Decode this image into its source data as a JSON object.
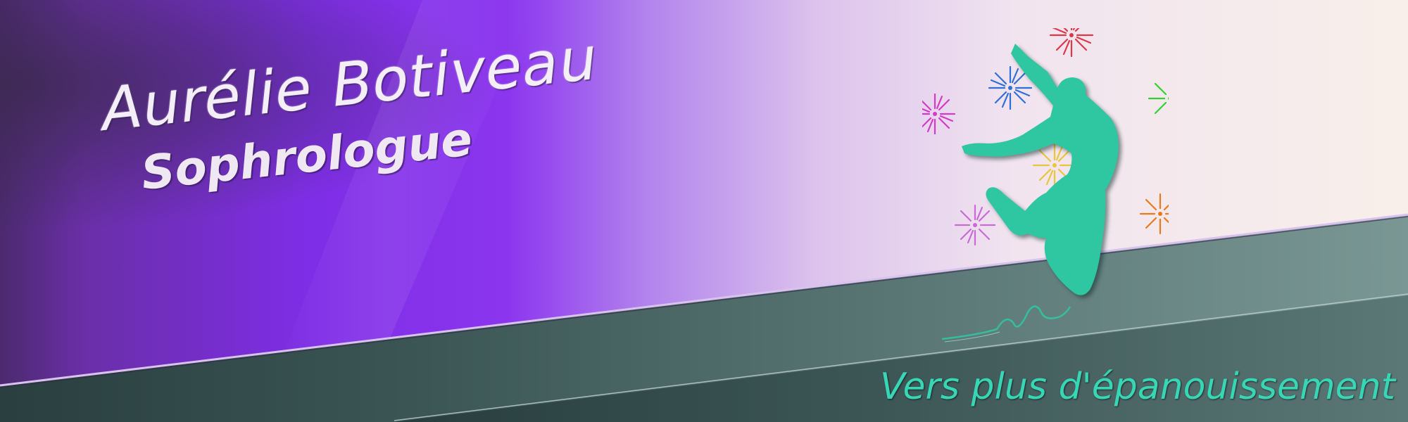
{
  "banner": {
    "name": "Aurélie Botiveau",
    "profession": "Sophrologue",
    "tagline": "Vers plus d'épanouissement"
  },
  "illustration": {
    "figure": "dancer-silhouette",
    "figure_color": "#2fc6a2",
    "firework_colors": [
      "#e0364a",
      "#2f6fd8",
      "#d43ac8",
      "#2fd02f",
      "#e8c63a",
      "#e87a1c",
      "#c96ad8"
    ]
  },
  "colors": {
    "purple": "#7a1fe6",
    "light_band": "#f2e6ee",
    "teal_dark": "#2e4b4a",
    "teal_light": "#6d8a88",
    "title_text": "#f4eef8",
    "tagline_text": "#37d6b4"
  }
}
